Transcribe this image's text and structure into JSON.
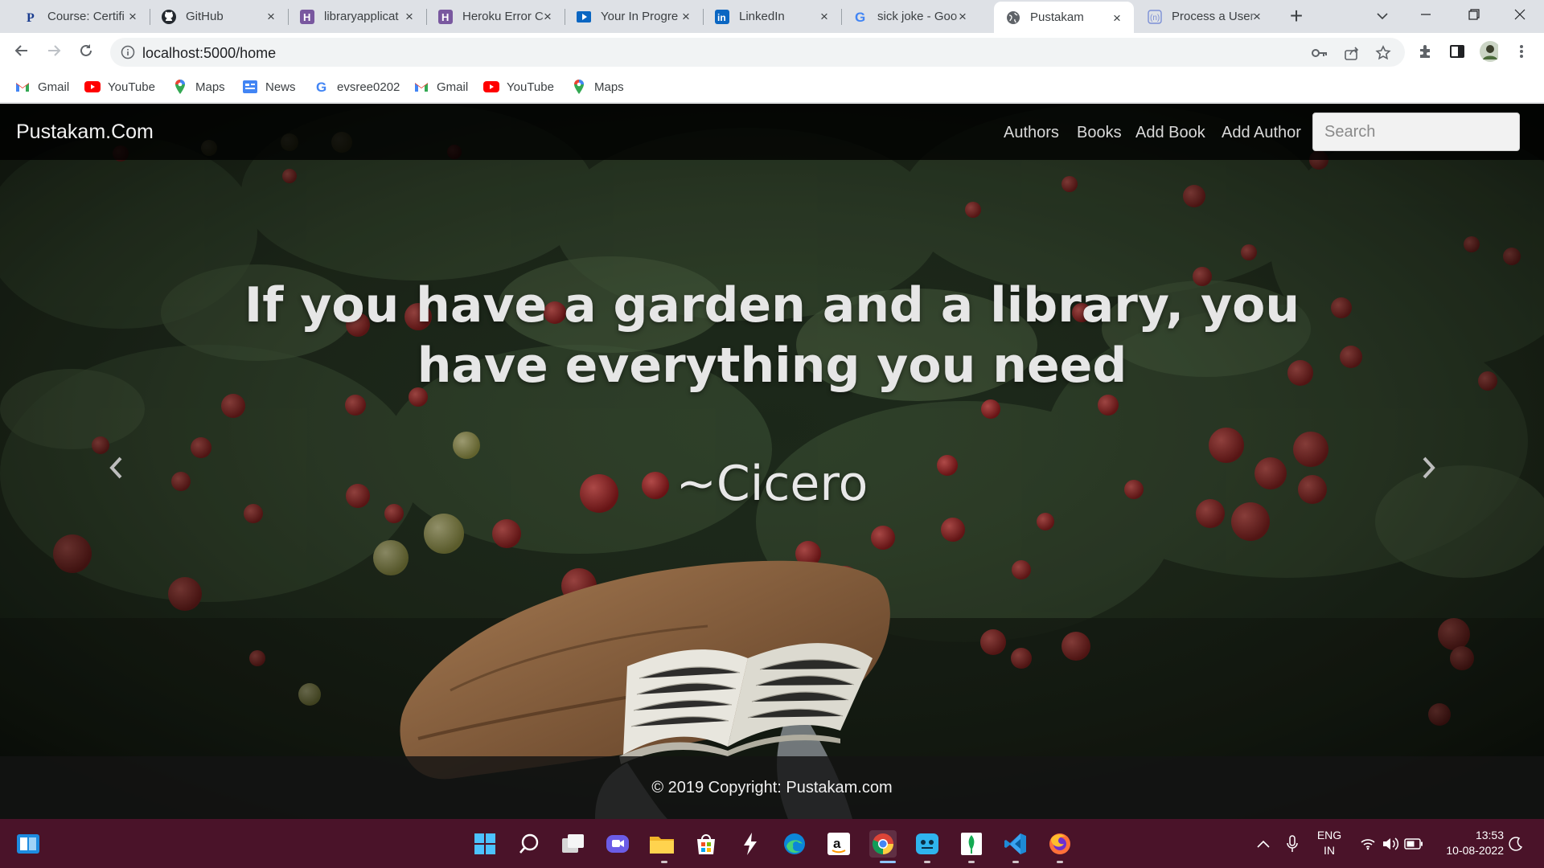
{
  "browser": {
    "tabs": [
      {
        "title": "Course: Certifi",
        "icon": "p-letter-icon",
        "active": false
      },
      {
        "title": "GitHub",
        "icon": "github-icon",
        "active": false
      },
      {
        "title": "libraryapplicat",
        "icon": "heroku-icon",
        "active": false
      },
      {
        "title": "Heroku Error C",
        "icon": "heroku-icon",
        "active": false
      },
      {
        "title": "Your In Progre",
        "icon": "video-icon",
        "active": false
      },
      {
        "title": "LinkedIn",
        "icon": "linkedin-icon",
        "active": false
      },
      {
        "title": "sick joke - Goo",
        "icon": "google-icon",
        "active": false
      },
      {
        "title": "Pustakam",
        "icon": "globe-icon",
        "active": true
      },
      {
        "title": "Process a User",
        "icon": "n-icon",
        "active": false
      }
    ],
    "url": "localhost:5000/home",
    "bookmarks": [
      {
        "label": "Gmail",
        "icon": "gmail-icon"
      },
      {
        "label": "YouTube",
        "icon": "youtube-icon"
      },
      {
        "label": "Maps",
        "icon": "maps-icon"
      },
      {
        "label": "News",
        "icon": "news-icon"
      },
      {
        "label": "evsree0202",
        "icon": "google-icon"
      },
      {
        "label": "Gmail",
        "icon": "gmail-icon"
      },
      {
        "label": "YouTube",
        "icon": "youtube-icon"
      },
      {
        "label": "Maps",
        "icon": "maps-icon"
      }
    ]
  },
  "site": {
    "brand": "Pustakam.Com",
    "nav": [
      "Authors",
      "Books",
      "Add Book",
      "Add Author"
    ],
    "search_placeholder": "Search",
    "quote": "If you have a garden and a library, you have everything you need",
    "quote_author": "~Cicero",
    "footer": "© 2019 Copyright: Pustakam.com"
  },
  "taskbar": {
    "apps": [
      "start-icon",
      "search-icon",
      "task-view-icon",
      "teams-chat-icon",
      "file-explorer-icon",
      "store-icon",
      "app-icon",
      "edge-icon",
      "amazon-icon",
      "chrome-icon",
      "app-icon",
      "mongodb-icon",
      "vscode-icon",
      "firefox-icon"
    ],
    "language": "ENG",
    "region": "IN",
    "time": "13:53",
    "date": "10-08-2022"
  },
  "colors": {
    "tabstrip": "#dee1e6",
    "navbar": "#0b0b0b",
    "taskbar": "#4a1329"
  }
}
